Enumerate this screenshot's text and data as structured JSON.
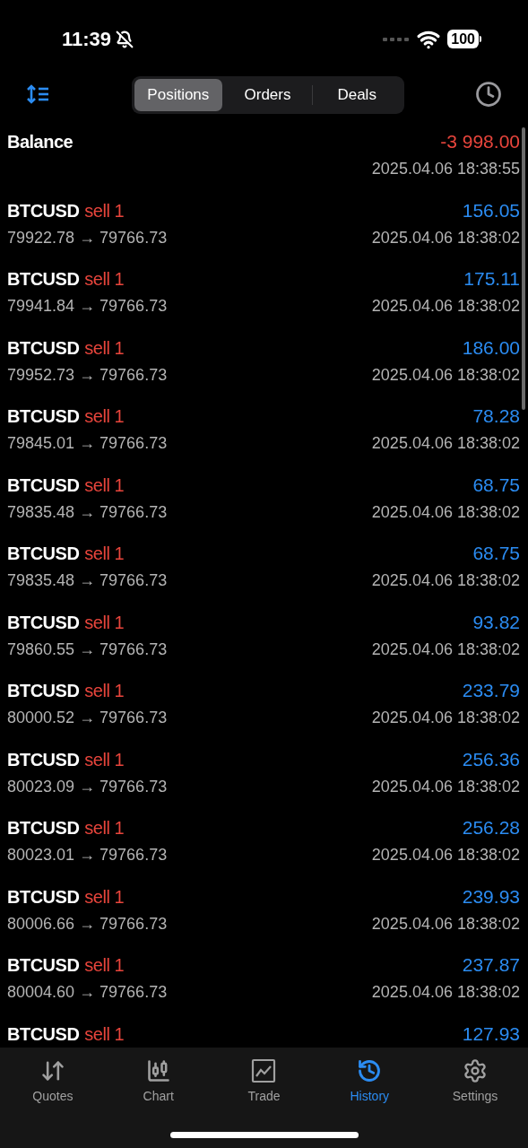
{
  "status_bar": {
    "time": "11:39",
    "battery": "100"
  },
  "segments": [
    {
      "label": "Positions",
      "selected": true
    },
    {
      "label": "Orders",
      "selected": false
    },
    {
      "label": "Deals",
      "selected": false
    }
  ],
  "rows": [
    {
      "kind": "balance",
      "title": "Balance",
      "amount": "-3 998.00",
      "loss": true,
      "time": "2025.04.06 18:38:55"
    },
    {
      "kind": "deal",
      "title": "BTCUSD",
      "side": "sell 1",
      "amount": "156.05",
      "loss": false,
      "prices": "79922.78 → 79766.73",
      "time": "2025.04.06 18:38:02"
    },
    {
      "kind": "deal",
      "title": "BTCUSD",
      "side": "sell 1",
      "amount": "175.11",
      "loss": false,
      "prices": "79941.84 → 79766.73",
      "time": "2025.04.06 18:38:02"
    },
    {
      "kind": "deal",
      "title": "BTCUSD",
      "side": "sell 1",
      "amount": "186.00",
      "loss": false,
      "prices": "79952.73 → 79766.73",
      "time": "2025.04.06 18:38:02"
    },
    {
      "kind": "deal",
      "title": "BTCUSD",
      "side": "sell 1",
      "amount": "78.28",
      "loss": false,
      "prices": "79845.01 → 79766.73",
      "time": "2025.04.06 18:38:02"
    },
    {
      "kind": "deal",
      "title": "BTCUSD",
      "side": "sell 1",
      "amount": "68.75",
      "loss": false,
      "prices": "79835.48 → 79766.73",
      "time": "2025.04.06 18:38:02"
    },
    {
      "kind": "deal",
      "title": "BTCUSD",
      "side": "sell 1",
      "amount": "68.75",
      "loss": false,
      "prices": "79835.48 → 79766.73",
      "time": "2025.04.06 18:38:02"
    },
    {
      "kind": "deal",
      "title": "BTCUSD",
      "side": "sell 1",
      "amount": "93.82",
      "loss": false,
      "prices": "79860.55 → 79766.73",
      "time": "2025.04.06 18:38:02"
    },
    {
      "kind": "deal",
      "title": "BTCUSD",
      "side": "sell 1",
      "amount": "233.79",
      "loss": false,
      "prices": "80000.52 → 79766.73",
      "time": "2025.04.06 18:38:02"
    },
    {
      "kind": "deal",
      "title": "BTCUSD",
      "side": "sell 1",
      "amount": "256.36",
      "loss": false,
      "prices": "80023.09 → 79766.73",
      "time": "2025.04.06 18:38:02"
    },
    {
      "kind": "deal",
      "title": "BTCUSD",
      "side": "sell 1",
      "amount": "256.28",
      "loss": false,
      "prices": "80023.01 → 79766.73",
      "time": "2025.04.06 18:38:02"
    },
    {
      "kind": "deal",
      "title": "BTCUSD",
      "side": "sell 1",
      "amount": "239.93",
      "loss": false,
      "prices": "80006.66 → 79766.73",
      "time": "2025.04.06 18:38:02"
    },
    {
      "kind": "deal",
      "title": "BTCUSD",
      "side": "sell 1",
      "amount": "237.87",
      "loss": false,
      "prices": "80004.60 → 79766.73",
      "time": "2025.04.06 18:38:02"
    },
    {
      "kind": "deal",
      "title": "BTCUSD",
      "side": "sell 1",
      "amount": "127.93",
      "loss": false
    }
  ],
  "tab_bar": [
    {
      "kind": "quotes",
      "label": "Quotes",
      "selected": false
    },
    {
      "kind": "chart",
      "label": "Chart",
      "selected": false
    },
    {
      "kind": "trade",
      "label": "Trade",
      "selected": false
    },
    {
      "kind": "history",
      "label": "History",
      "selected": true
    },
    {
      "kind": "settings",
      "label": "Settings",
      "selected": false
    }
  ]
}
